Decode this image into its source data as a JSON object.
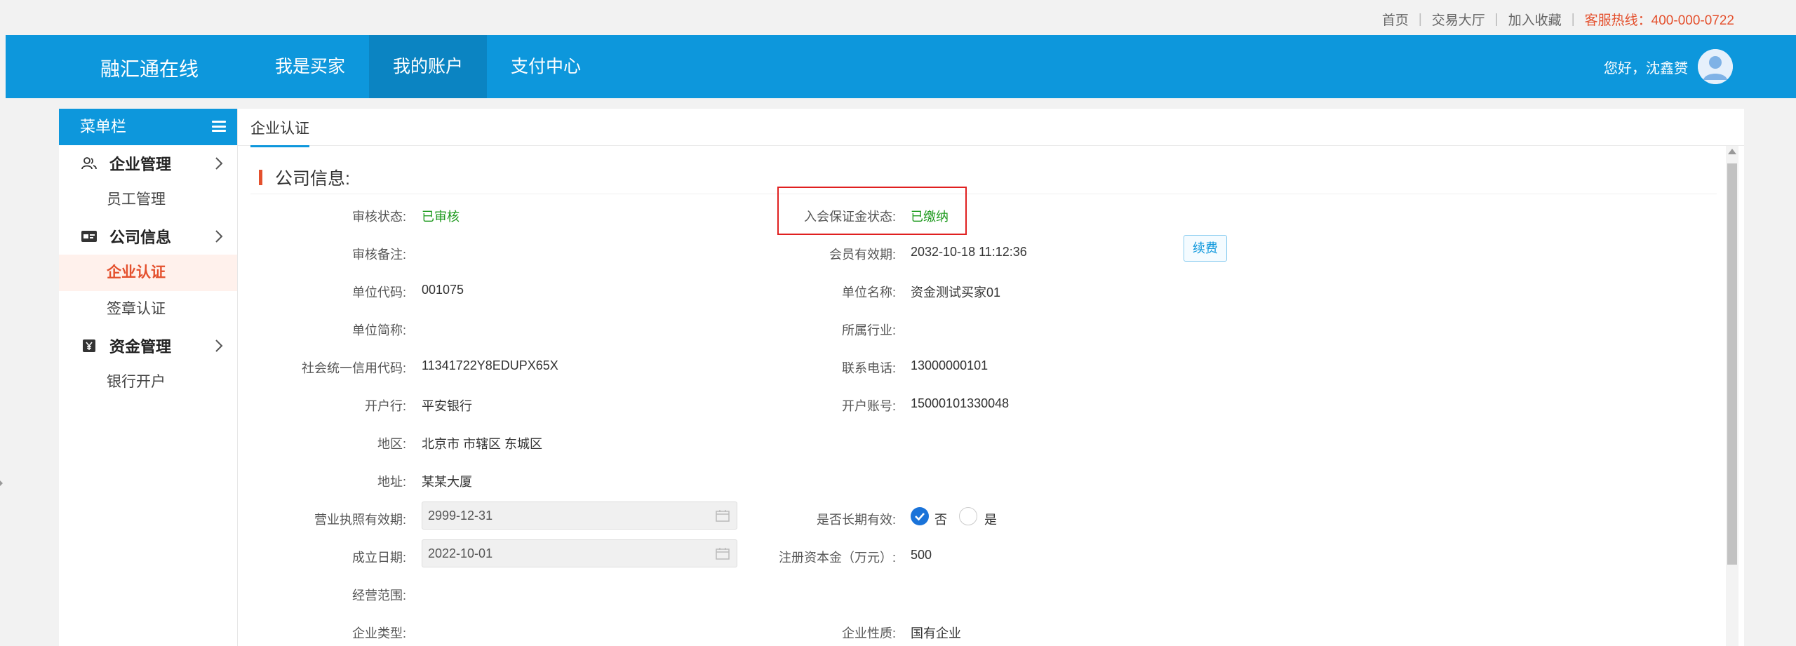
{
  "topbar": {
    "links": [
      "首页",
      "交易大厅",
      "加入收藏"
    ],
    "hotline": "客服热线：400-000-0722"
  },
  "header": {
    "logo": "融汇通在线",
    "nav": [
      {
        "label": "我是买家",
        "active": false
      },
      {
        "label": "我的账户",
        "active": true
      },
      {
        "label": "支付中心",
        "active": false
      }
    ],
    "greeting": "您好，沈鑫赟"
  },
  "sidebar": {
    "title": "菜单栏",
    "groups": [
      {
        "label": "企业管理",
        "icon": "users-icon",
        "items": [
          "员工管理"
        ]
      },
      {
        "label": "公司信息",
        "icon": "id-card-icon",
        "items": [
          "企业认证",
          "签章认证"
        ]
      },
      {
        "label": "资金管理",
        "icon": "yen-icon",
        "items": [
          "银行开户"
        ]
      }
    ],
    "active_item": "企业认证"
  },
  "content": {
    "tab": "企业认证",
    "section_title": "公司信息:",
    "fields_left": [
      {
        "label": "审核状态:",
        "value": "已审核"
      },
      {
        "label": "审核备注:",
        "value": ""
      },
      {
        "label": "单位代码:",
        "value": "001075"
      },
      {
        "label": "单位简称:",
        "value": ""
      },
      {
        "label": "社会统一信用代码:",
        "value": "11341722Y8EDUPX65X"
      },
      {
        "label": "开户行:",
        "value": "平安银行"
      },
      {
        "label": "地区:",
        "value": "北京市 市辖区 东城区"
      },
      {
        "label": "地址:",
        "value": "某某大厦"
      },
      {
        "label": "营业执照有效期:",
        "value": "2999-12-31"
      },
      {
        "label": "成立日期:",
        "value": "2022-10-01"
      },
      {
        "label": "经营范围:",
        "value": ""
      },
      {
        "label": "企业类型:",
        "value": ""
      }
    ],
    "fields_right": [
      {
        "label": "入会保证金状态:",
        "value": "已缴纳"
      },
      {
        "label": "会员有效期:",
        "value": "2032-10-18 11:12:36"
      },
      {
        "label": "单位名称:",
        "value": "资金测试买家01"
      },
      {
        "label": "所属行业:",
        "value": ""
      },
      {
        "label": "联系电话:",
        "value": "13000000101"
      },
      {
        "label": "开户账号:",
        "value": "15000101330048"
      },
      {
        "label": "是否长期有效:",
        "value": ""
      },
      {
        "label": "注册资本金（万元）:",
        "value": "500"
      },
      {
        "label": "企业性质:",
        "value": "国有企业"
      }
    ],
    "renew_button": "续费",
    "long_term_options": {
      "no": "否",
      "yes": "是",
      "selected": "no"
    }
  },
  "colors": {
    "primary": "#0d97dc",
    "accent": "#e4502d",
    "success": "#1e9a1e",
    "highlight": "#e02020"
  }
}
